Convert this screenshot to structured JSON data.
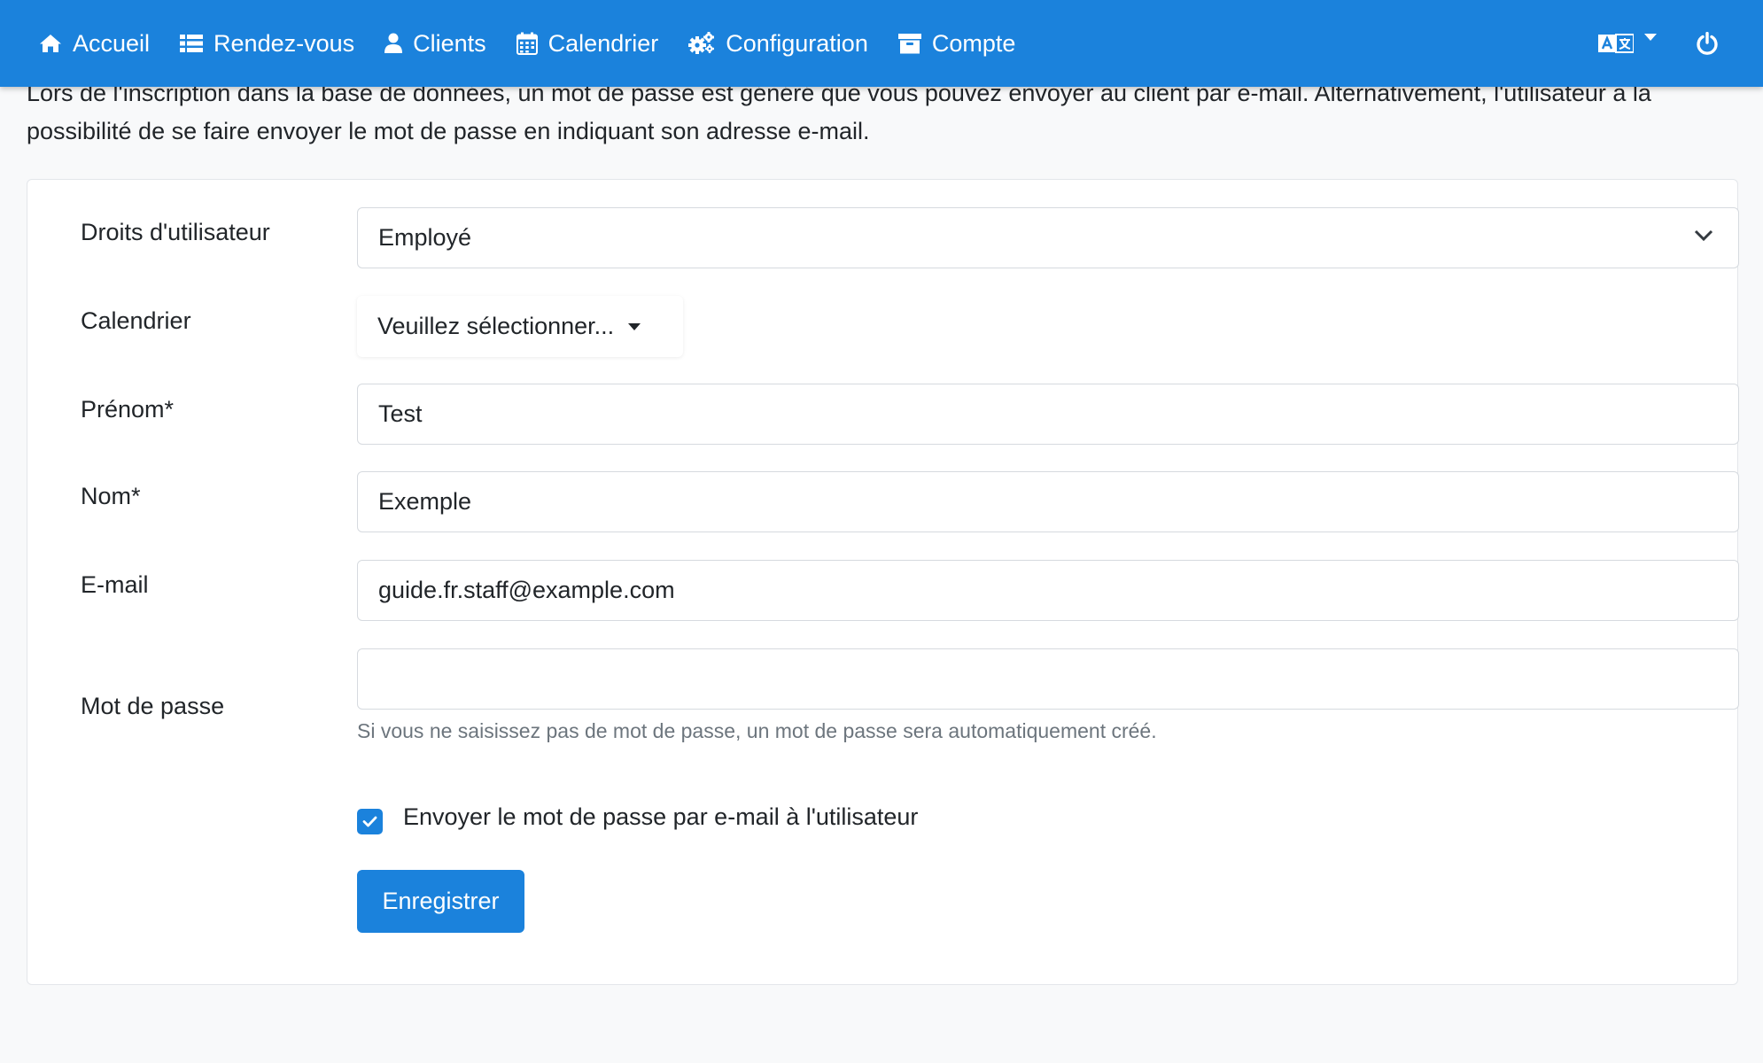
{
  "nav": {
    "items": [
      {
        "label": "Accueil",
        "icon": "home-icon"
      },
      {
        "label": "Rendez-vous",
        "icon": "list-icon"
      },
      {
        "label": "Clients",
        "icon": "user-icon"
      },
      {
        "label": "Calendrier",
        "icon": "calendar-icon"
      },
      {
        "label": "Configuration",
        "icon": "cogs-icon"
      },
      {
        "label": "Compte",
        "icon": "archive-icon"
      }
    ],
    "right": {
      "language_icon": "language-icon",
      "logout_icon": "power-icon"
    }
  },
  "intro_text": "Lors de l'inscription dans la base de données, un mot de passe est généré que vous pouvez envoyer au client par e-mail. Alternativement, l'utilisateur a la possibilité de se faire envoyer le mot de passe en indiquant son adresse e-mail.",
  "form": {
    "rights": {
      "label": "Droits d'utilisateur",
      "value": "Employé"
    },
    "calendar": {
      "label": "Calendrier",
      "value": "Veuillez sélectionner..."
    },
    "firstname": {
      "label": "Prénom*",
      "value": "Test"
    },
    "lastname": {
      "label": "Nom*",
      "value": "Exemple"
    },
    "email": {
      "label": "E-mail",
      "value": "guide.fr.staff@example.com"
    },
    "password": {
      "label": "Mot de passe",
      "value": "",
      "help": "Si vous ne saisissez pas de mot de passe, un mot de passe sera automatiquement créé."
    },
    "send_password": {
      "label": "Envoyer le mot de passe par e-mail à l'utilisateur",
      "checked": true
    },
    "save_label": "Enregistrer"
  },
  "colors": {
    "primary": "#1b82dc",
    "background": "#f8f9fa",
    "muted": "#6c757d"
  }
}
